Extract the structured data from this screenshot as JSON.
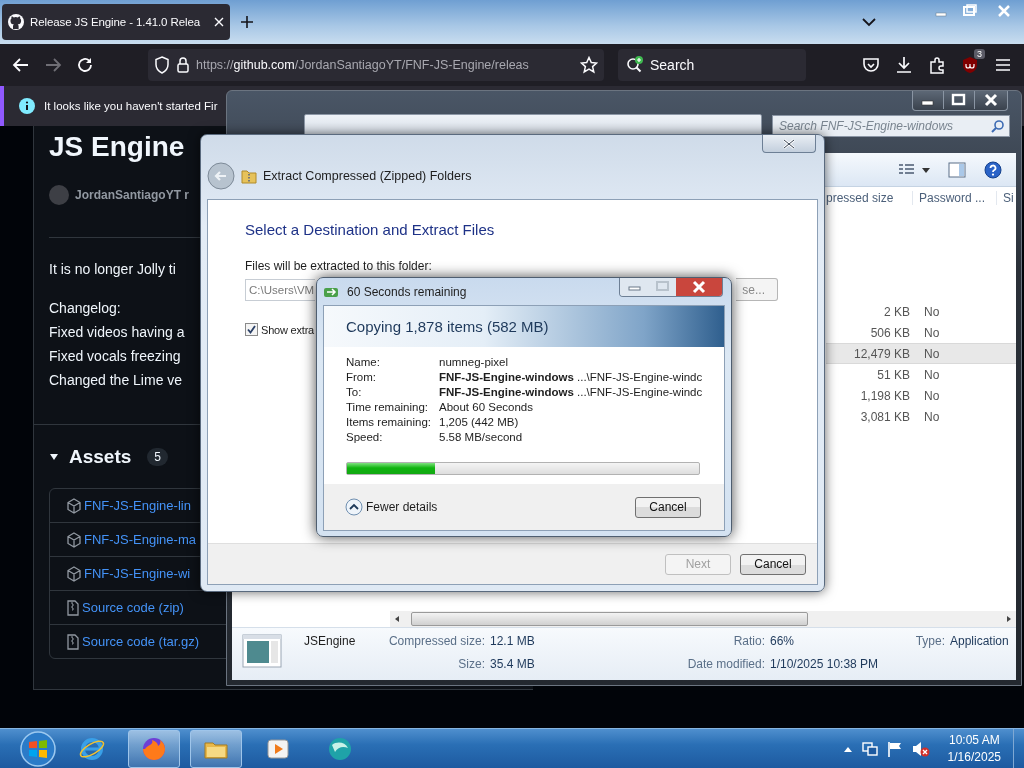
{
  "browser": {
    "tab": {
      "title": "Release JS Engine - 1.41.0 Relea",
      "selected": true
    },
    "url": {
      "scheme": "https://",
      "host": "github.com",
      "path": "/JordanSantiagoYT/FNF-JS-Engine/releas"
    },
    "search": {
      "placeholder": "Search"
    },
    "extension_badge": "3",
    "notification": "It looks like you haven't started Fir"
  },
  "release": {
    "title": "JS Engine",
    "author": "JordanSantiagoYT r",
    "paragraphs": [
      "It is no longer Jolly ti"
    ],
    "changelog": [
      "Changelog:",
      "Fixed videos having a",
      "Fixed vocals freezing",
      "Changed the Lime ve"
    ],
    "assets": {
      "label": "Assets",
      "count": "5",
      "expanded": true,
      "items": [
        {
          "kind": "package",
          "name": "FNF-JS-Engine-lin"
        },
        {
          "kind": "package",
          "name": "FNF-JS-Engine-ma"
        },
        {
          "kind": "package",
          "name": "FNF-JS-Engine-wi"
        },
        {
          "kind": "archive",
          "name": "Source code (zip)"
        },
        {
          "kind": "archive",
          "name": "Source code (tar.gz)"
        }
      ]
    }
  },
  "explorer": {
    "search": {
      "placeholder": "Search FNF-JS-Engine-windows"
    },
    "columns": [
      "pressed size",
      "Password ...",
      "Si"
    ],
    "rows": [
      {
        "size": "2 KB",
        "password": "No",
        "selected": false
      },
      {
        "size": "506 KB",
        "password": "No",
        "selected": false
      },
      {
        "size": "12,479 KB",
        "password": "No",
        "selected": true
      },
      {
        "size": "51 KB",
        "password": "No",
        "selected": false
      },
      {
        "size": "1,198 KB",
        "password": "No",
        "selected": false
      },
      {
        "size": "3,081 KB",
        "password": "No",
        "selected": false
      }
    ],
    "details": {
      "name": "JSEngine",
      "fields": [
        {
          "label": "Compressed size:",
          "value": "12.1 MB"
        },
        {
          "label": "Size:",
          "value": "35.4 MB"
        },
        {
          "label": "Ratio:",
          "value": "66%"
        },
        {
          "label": "Date modified:",
          "value": "1/10/2025 10:38 PM"
        },
        {
          "label": "Type:",
          "value": "Application"
        }
      ]
    }
  },
  "extract": {
    "title": "Extract Compressed (Zipped) Folders",
    "heading": "Select a Destination and Extract Files",
    "folder_label": "Files will be extracted to this folder:",
    "folder_path": "C:\\Users\\VM",
    "browse": "se...",
    "show_files": {
      "label": "Show extra",
      "checked": true
    },
    "buttons": [
      {
        "label": "Next",
        "disabled": true
      },
      {
        "label": "Cancel",
        "disabled": false
      }
    ]
  },
  "copy": {
    "title": "60 Seconds remaining",
    "heading": "Copying 1,878 items (582 MB)",
    "details": [
      {
        "label": "Name:",
        "value": "numneg-pixel"
      },
      {
        "label": "From:",
        "value": "**FNF-JS-Engine-windows** ...\\FNF-JS-Engine-windc"
      },
      {
        "label": "To:",
        "value": "**FNF-JS-Engine-windows** ...\\FNF-JS-Engine-windc"
      },
      {
        "label": "Time remaining:",
        "value": "About 60 Seconds"
      },
      {
        "label": "Items remaining:",
        "value": "1,205 (442 MB)"
      },
      {
        "label": "Speed:",
        "value": "5.58 MB/second"
      }
    ],
    "progress": {
      "level": 0.25
    },
    "details_toggle": "Fewer details",
    "expanded": true,
    "cancel": "Cancel"
  },
  "taskbar": {
    "apps": [
      {
        "kind": "ie",
        "selected": false
      },
      {
        "kind": "firefox",
        "selected": true
      },
      {
        "kind": "folder",
        "selected": true
      },
      {
        "kind": "media",
        "selected": false
      },
      {
        "kind": "globe",
        "selected": false
      }
    ],
    "time": "10:05 AM",
    "date": "1/16/2025"
  }
}
